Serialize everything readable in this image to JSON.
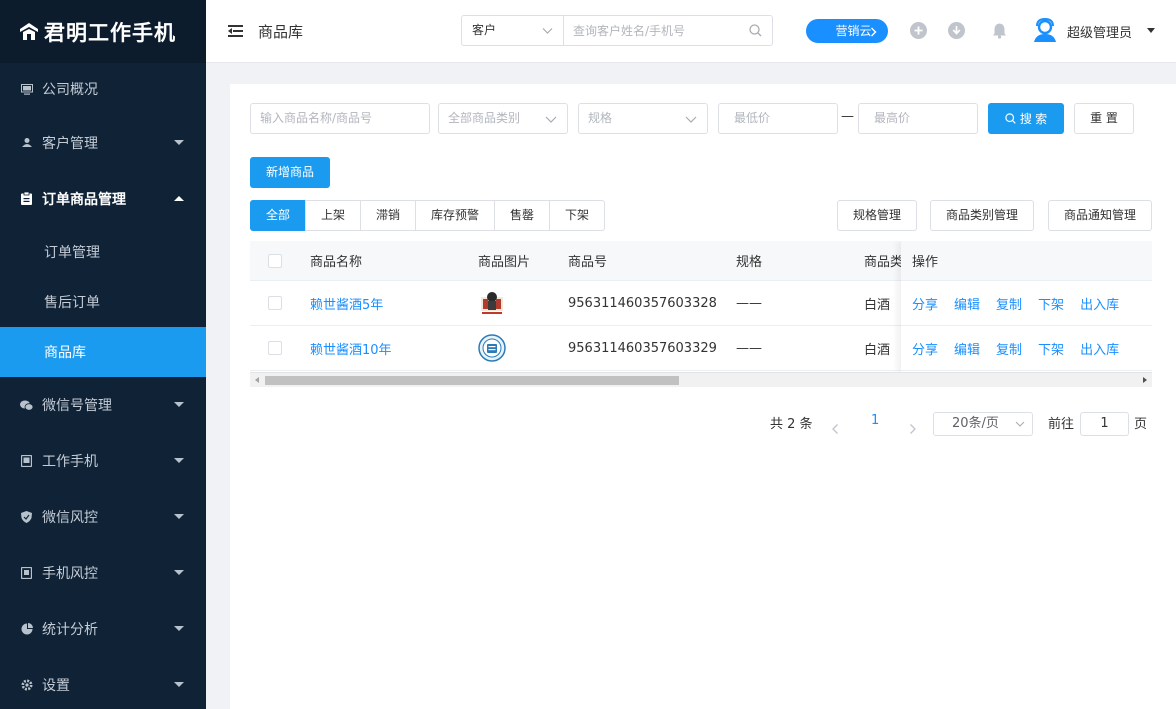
{
  "app": {
    "logo_text": "君明工作手机"
  },
  "sidebar": {
    "items": [
      {
        "label": "公司概况",
        "icon": "monitor-icon"
      },
      {
        "label": "客户管理",
        "icon": "users-icon"
      },
      {
        "label": "订单商品管理",
        "icon": "clipboard-icon"
      },
      {
        "label": "微信号管理",
        "icon": "wechat-icon"
      },
      {
        "label": "工作手机",
        "icon": "tablet-icon"
      },
      {
        "label": "微信风控",
        "icon": "shield-icon"
      },
      {
        "label": "手机风控",
        "icon": "phone-box-icon"
      },
      {
        "label": "统计分析",
        "icon": "pie-chart-icon"
      },
      {
        "label": "设置",
        "icon": "gear-icon"
      }
    ],
    "submenu": [
      {
        "label": "订单管理"
      },
      {
        "label": "售后订单"
      },
      {
        "label": "商品库"
      }
    ],
    "active_submenu": "商品库"
  },
  "header": {
    "page_title": "商品库",
    "search_type": "客户",
    "search_placeholder": "查询客户姓名/手机号",
    "yxy_label": "营销云",
    "username": "超级管理员"
  },
  "filters": {
    "name_placeholder": "输入商品名称/商品号",
    "category_placeholder": "全部商品类别",
    "spec_placeholder": "规格",
    "min_price_placeholder": "最低价",
    "range_dash": "—",
    "max_price_placeholder": "最高价",
    "search_label": "搜 索",
    "reset_label": "重 置"
  },
  "add_button": "新增商品",
  "tabs": [
    "全部",
    "上架",
    "滞销",
    "库存预警",
    "售罄",
    "下架"
  ],
  "management_buttons": [
    "规格管理",
    "商品类别管理",
    "商品通知管理"
  ],
  "table": {
    "columns": [
      "商品名称",
      "商品图片",
      "商品号",
      "规格",
      "商品类",
      "操作"
    ],
    "rows": [
      {
        "name": "赖世酱酒5年",
        "sku": "956311460357603328",
        "spec": "——",
        "category": "白酒"
      },
      {
        "name": "赖世酱酒10年",
        "sku": "956311460357603329",
        "spec": "——",
        "category": "白酒"
      }
    ],
    "actions": [
      "分享",
      "编辑",
      "复制",
      "下架",
      "出入库"
    ]
  },
  "pagination": {
    "total_label": "共 2 条",
    "current_page": "1",
    "page_size": "20条/页",
    "goto_label": "前往",
    "goto_value": "1",
    "page_suffix": "页"
  },
  "colors": {
    "primary": "#1a9bf0",
    "sidebar_bg": "#0f2236",
    "link": "#1a8fff"
  }
}
